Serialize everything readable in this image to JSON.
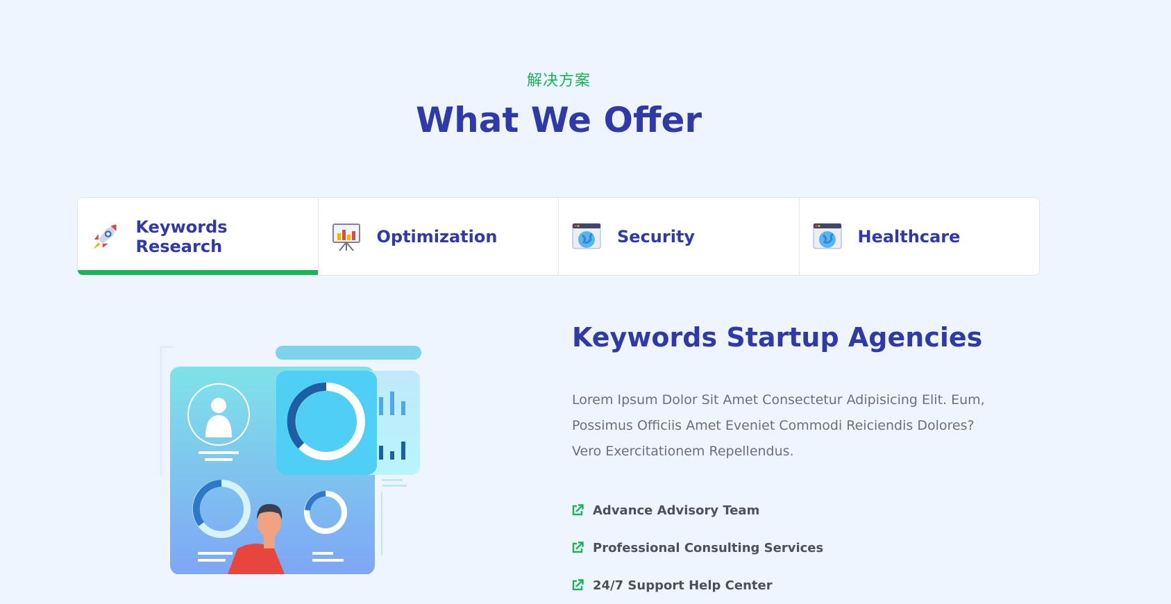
{
  "header": {
    "subtitle": "解决方案",
    "title": "What We Offer"
  },
  "tabs": [
    {
      "label": "Keywords Research",
      "icon": "rocket-icon",
      "active": true
    },
    {
      "label": "Optimization",
      "icon": "presentation-chart-icon",
      "active": false
    },
    {
      "label": "Security",
      "icon": "browser-globe-icon",
      "active": false
    },
    {
      "label": "Healthcare",
      "icon": "browser-globe-icon",
      "active": false
    }
  ],
  "content": {
    "title": "Keywords Startup Agencies",
    "description": "Lorem Ipsum Dolor Sit Amet Consectetur Adipisicing Elit. Eum, Possimus Officiis Amet Eveniet Commodi Reiciendis Dolores? Vero Exercitationem Repellendus.",
    "features": [
      "Advance Advisory Team",
      "Professional Consulting Services",
      "24/7 Support Help Center"
    ]
  },
  "colors": {
    "accent": "#18b35a",
    "heading": "#2f3aa8",
    "background": "#eef5fe"
  }
}
